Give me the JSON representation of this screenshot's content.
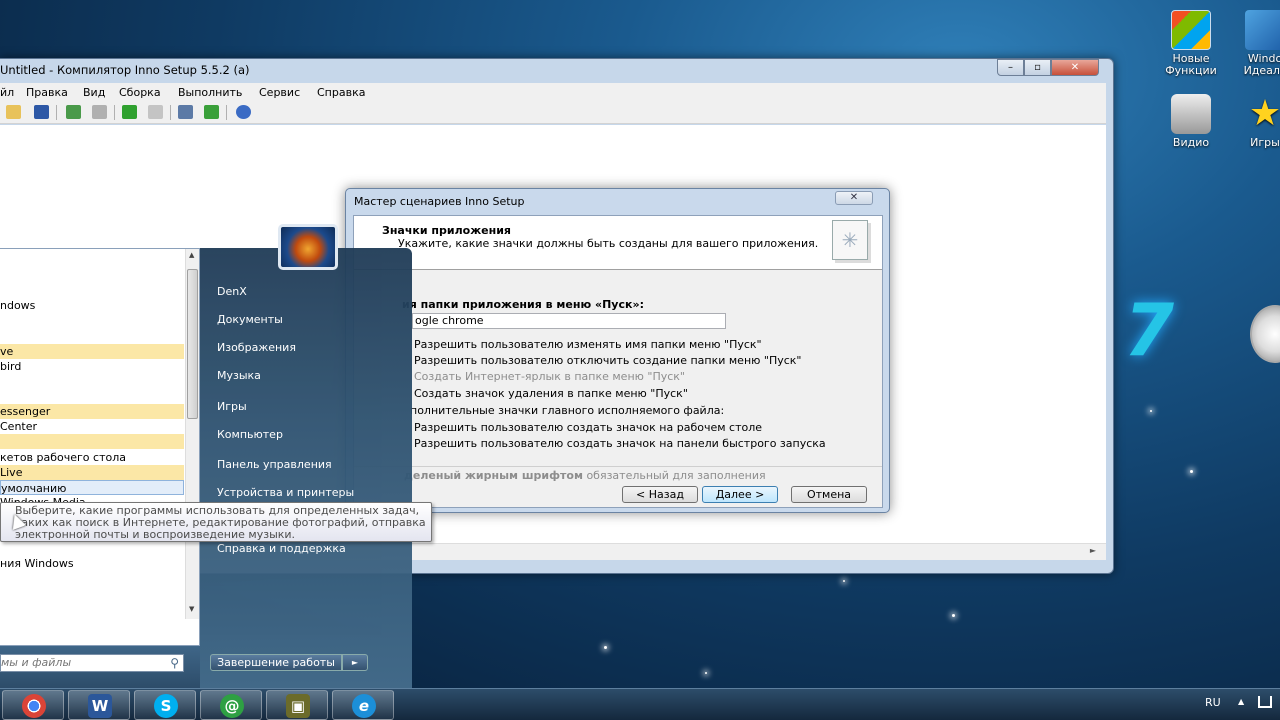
{
  "desktop": {
    "icons": [
      {
        "label_line1": "Новые",
        "label_line2": "Функции"
      },
      {
        "label_line1": "Windo",
        "label_line2": "Идеаль"
      },
      {
        "label_line1": "Видио",
        "label_line2": ""
      },
      {
        "label_line1": "Игры",
        "label_line2": ""
      }
    ],
    "wallpaper_number": "7"
  },
  "inno": {
    "title": "Untitled - Компилятор Inno Setup 5.5.2 (a)",
    "controls": {
      "minimize": "–",
      "maximize": "▫",
      "close": "✕"
    },
    "menu": [
      "йл",
      "Правка",
      "Вид",
      "Сборка",
      "Выполнить",
      "Сервис",
      "Справка"
    ],
    "scroll_arrow": "►"
  },
  "wizard": {
    "title": "Мастер сценариев Inno Setup",
    "close": "✕",
    "header_title": "Значки приложения",
    "header_subtitle": "Укажите, какие значки должны быть созданы для вашего приложения.",
    "folder_label": "ия папки приложения в меню «Пуск»:",
    "folder_value": "ogle chrome",
    "options": [
      {
        "label": "Разрешить пользователю изменять имя папки меню \"Пуск\"",
        "enabled": true
      },
      {
        "label": "Разрешить пользователю отключить создание папки меню \"Пуск\"",
        "enabled": true
      },
      {
        "label": "Создать Интернет-ярлык в папке меню \"Пуск\"",
        "enabled": false
      },
      {
        "label": "Создать значок удаления в папке меню \"Пуск\"",
        "enabled": true
      }
    ],
    "extra_label": "полнительные значки главного исполняемого файла:",
    "extra_options": [
      {
        "label": "Разрешить пользователю создать значок на рабочем столе"
      },
      {
        "label": "Разрешить пользователю создать значок на панели быстрого запуска"
      }
    ],
    "footer_note_bold": "деленый жирным шрифтом",
    "footer_note_rest": " обязательный для заполнения",
    "buttons": {
      "back": "< Назад",
      "next": "Далее >",
      "cancel": "Отмена"
    }
  },
  "start_menu": {
    "left_items": [
      {
        "text": "ndows",
        "style": "plain"
      },
      {
        "text": "ve",
        "style": "hl"
      },
      {
        "text": "bird",
        "style": "plain"
      },
      {
        "text": "essenger",
        "style": "hl"
      },
      {
        "text": "Center",
        "style": "plain"
      },
      {
        "text": "",
        "style": "hl"
      },
      {
        "text": "кетов рабочего стола",
        "style": "plain"
      },
      {
        "text": " Live",
        "style": "hl"
      },
      {
        "text": "умолчанию",
        "style": "sel"
      },
      {
        "text": "Windows Media",
        "style": "plain"
      },
      {
        "text": "ния Windows",
        "style": "plain"
      }
    ],
    "right_items": [
      "DenX",
      "Документы",
      "Изображения",
      "Музыка",
      "Игры",
      "Компьютер",
      "Панель управления",
      "Устройства и принтеры",
      "Справка и поддержка"
    ],
    "search_placeholder": "мы и файлы",
    "shutdown_label": "Завершение работы",
    "shutdown_arrow": "►",
    "scroll_up": "▲",
    "scroll_down": "▼"
  },
  "tooltip": {
    "line1": "Выберите, какие программы использовать для определенных задач,",
    "line2": "таких как поиск в Интернете, редактирование фотографий, отправка",
    "line3": "электронной почты и воспроизведение музыки."
  },
  "taskbar": {
    "apps": [
      {
        "name": "chrome",
        "glyph": "●",
        "color": "#d94a38"
      },
      {
        "name": "word",
        "glyph": "W",
        "color": "#2b579a"
      },
      {
        "name": "skype",
        "glyph": "S",
        "color": "#00aff0"
      },
      {
        "name": "mail-agent",
        "glyph": "@",
        "color": "#2ea043"
      },
      {
        "name": "video-app",
        "glyph": "▣",
        "color": "#6b6b2a"
      },
      {
        "name": "ie",
        "glyph": "e",
        "color": "#1c8fd8"
      }
    ],
    "lang": "RU"
  }
}
